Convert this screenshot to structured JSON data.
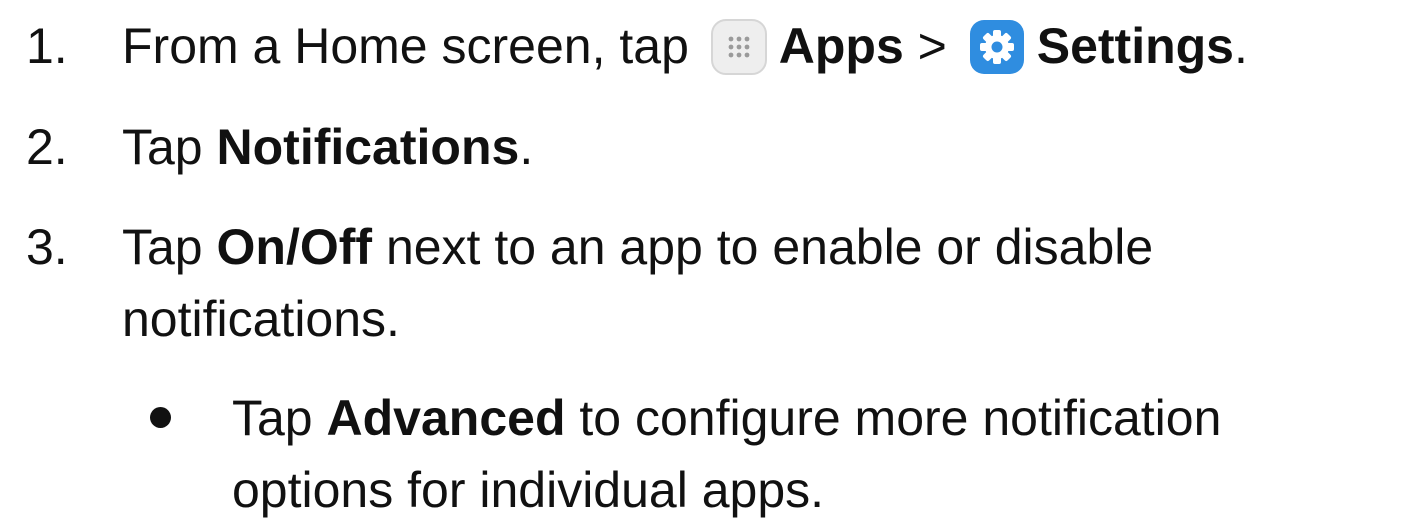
{
  "steps": [
    {
      "number": "1.",
      "pre": "From a Home screen, tap ",
      "apps_label": "Apps",
      "separator": " > ",
      "settings_label": "Settings",
      "end": ".",
      "icons": [
        "apps-grid-icon",
        "settings-gear-icon"
      ]
    },
    {
      "number": "2.",
      "pre": "Tap ",
      "bold": "Notifications",
      "end": "."
    },
    {
      "number": "3.",
      "pre": "Tap ",
      "bold": "On/Off",
      "post_line1": " next to an app to enable or disable",
      "line2": "notifications."
    }
  ],
  "sub_bullet": {
    "pre": "Tap ",
    "bold": "Advanced",
    "post_line1": " to configure more notification",
    "line2": "options for individual apps."
  },
  "colors": {
    "text": "#111111",
    "settings_icon_blue": "#2f8de0",
    "apps_icon_bg": "#eeeeee"
  }
}
